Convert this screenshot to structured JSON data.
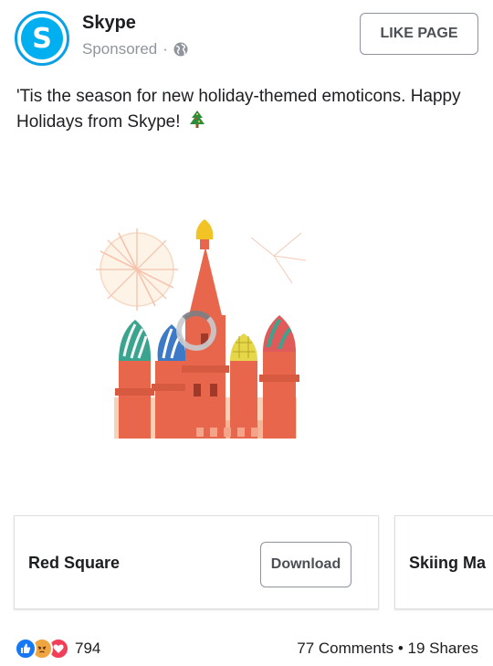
{
  "post": {
    "page_name": "Skype",
    "sponsored_label": "Sponsored",
    "separator": "·",
    "like_page_label": "LIKE PAGE",
    "text": "'Tis the season for new holiday-themed emoticons. Happy Holidays from Skype!",
    "text_emoji": "christmas-tree"
  },
  "carousel": {
    "cards": [
      {
        "title": "Red Square",
        "button": "Download"
      },
      {
        "title": "Skiing Ma"
      }
    ]
  },
  "footer": {
    "reaction_count": "794",
    "comments": "77 Comments",
    "separator": "•",
    "shares": "19 Shares"
  },
  "colors": {
    "skype_blue": "#00aff0",
    "like_blue": "#1877f2",
    "angry_orange": "#f0a640",
    "love_red": "#f33e58"
  },
  "icons": [
    "skype-logo-icon",
    "globe-icon",
    "christmas-tree-icon",
    "like-reaction-icon",
    "angry-reaction-icon",
    "love-reaction-icon",
    "loading-spinner-icon"
  ]
}
